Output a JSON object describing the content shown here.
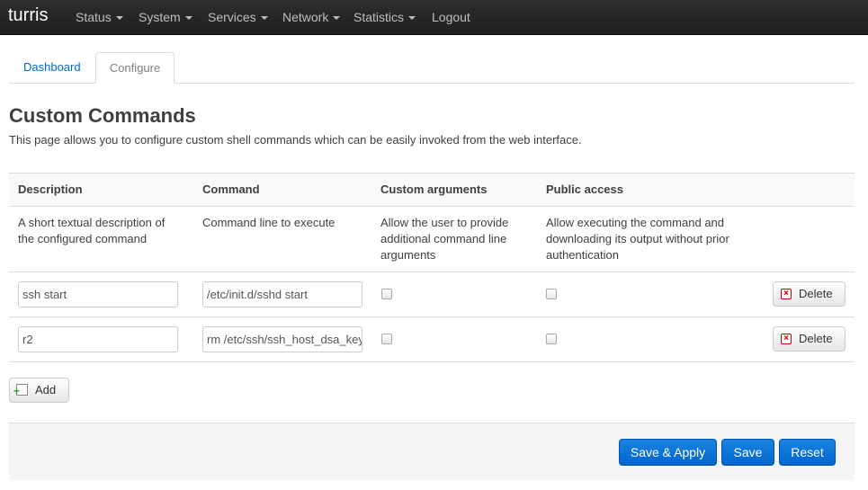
{
  "navbar": {
    "brand": "turris",
    "items": [
      {
        "label": "Status",
        "dropdown": true
      },
      {
        "label": "System",
        "dropdown": true
      },
      {
        "label": "Services",
        "dropdown": true
      },
      {
        "label": "Network",
        "dropdown": true
      },
      {
        "label": "Statistics",
        "dropdown": true
      },
      {
        "label": "Logout",
        "dropdown": false
      }
    ]
  },
  "tabs": [
    {
      "label": "Dashboard",
      "active": false
    },
    {
      "label": "Configure",
      "active": true
    }
  ],
  "page": {
    "title": "Custom Commands",
    "description": "This page allows you to configure custom shell commands which can be easily invoked from the web interface."
  },
  "table": {
    "headers": [
      "Description",
      "Command",
      "Custom arguments",
      "Public access"
    ],
    "descriptions": [
      "A short textual description of the configured command",
      "Command line to execute",
      "Allow the user to provide additional command line arguments",
      "Allow executing the command and downloading its output without prior authentication"
    ],
    "rows": [
      {
        "description": "ssh start",
        "command": "/etc/init.d/sshd start",
        "custom_arguments": false,
        "public_access": false,
        "delete_label": "Delete"
      },
      {
        "description": "r2",
        "command": "rm /etc/ssh/ssh_host_dsa_key",
        "custom_arguments": false,
        "public_access": false,
        "delete_label": "Delete"
      }
    ]
  },
  "add_label": "Add",
  "actions": {
    "save_apply": "Save & Apply",
    "save": "Save",
    "reset": "Reset"
  },
  "colors": {
    "navbar_bg": "#222222",
    "primary": "#0064cd",
    "link": "#0069d6"
  }
}
